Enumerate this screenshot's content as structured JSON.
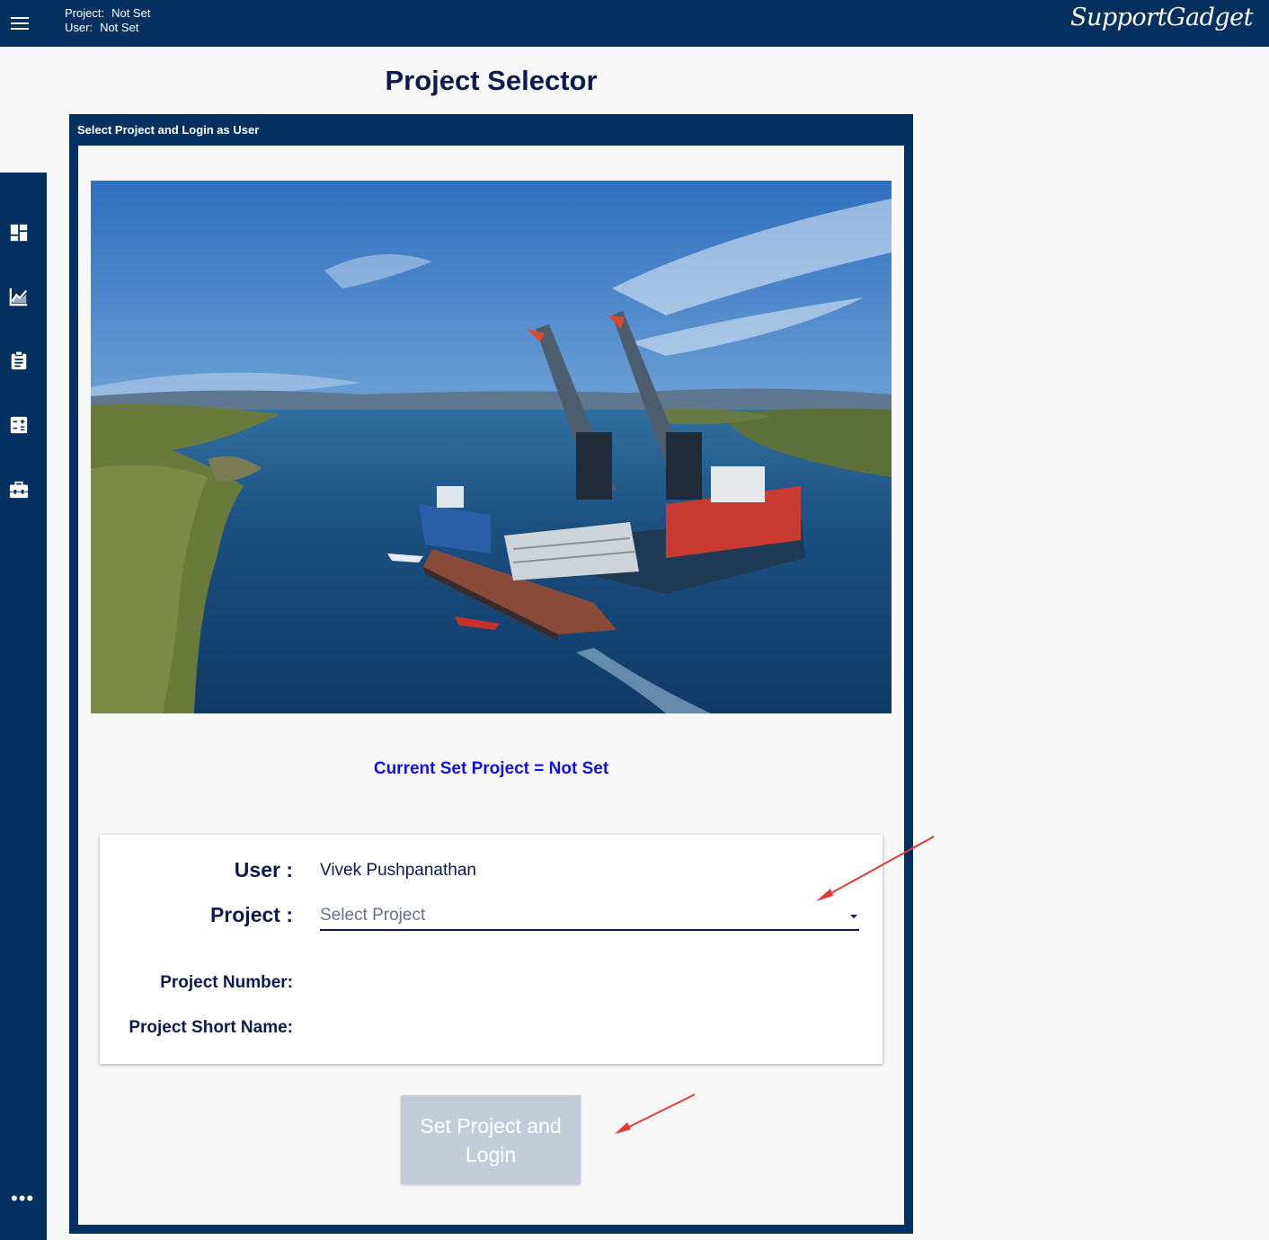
{
  "header": {
    "project_key": "Project:",
    "project_value": "Not Set",
    "user_key": "User:",
    "user_value": "Not Set",
    "brand": "SupportGadget"
  },
  "sidebar": {
    "items": [
      {
        "icon": "dashboard-icon"
      },
      {
        "icon": "chart-icon"
      },
      {
        "icon": "clipboard-icon"
      },
      {
        "icon": "calculator-icon"
      },
      {
        "icon": "toolbox-icon"
      }
    ],
    "more_label": "•••"
  },
  "page": {
    "title": "Project Selector",
    "panel_title": "Select Project and Login as User",
    "current_project": "Current Set Project = Not Set"
  },
  "form": {
    "user_label": "User :",
    "user_value": "Vivek Pushpanathan",
    "project_label": "Project :",
    "project_placeholder": "Select Project",
    "project_number_label": "Project Number:",
    "project_short_name_label": "Project Short Name:",
    "submit_label": "Set Project and Login"
  },
  "colors": {
    "navy": "#03305f",
    "title": "#0d1a4f",
    "link_blue": "#1010e6",
    "disabled_button": "#c3cdd9",
    "annotation_arrow": "#e53935"
  }
}
